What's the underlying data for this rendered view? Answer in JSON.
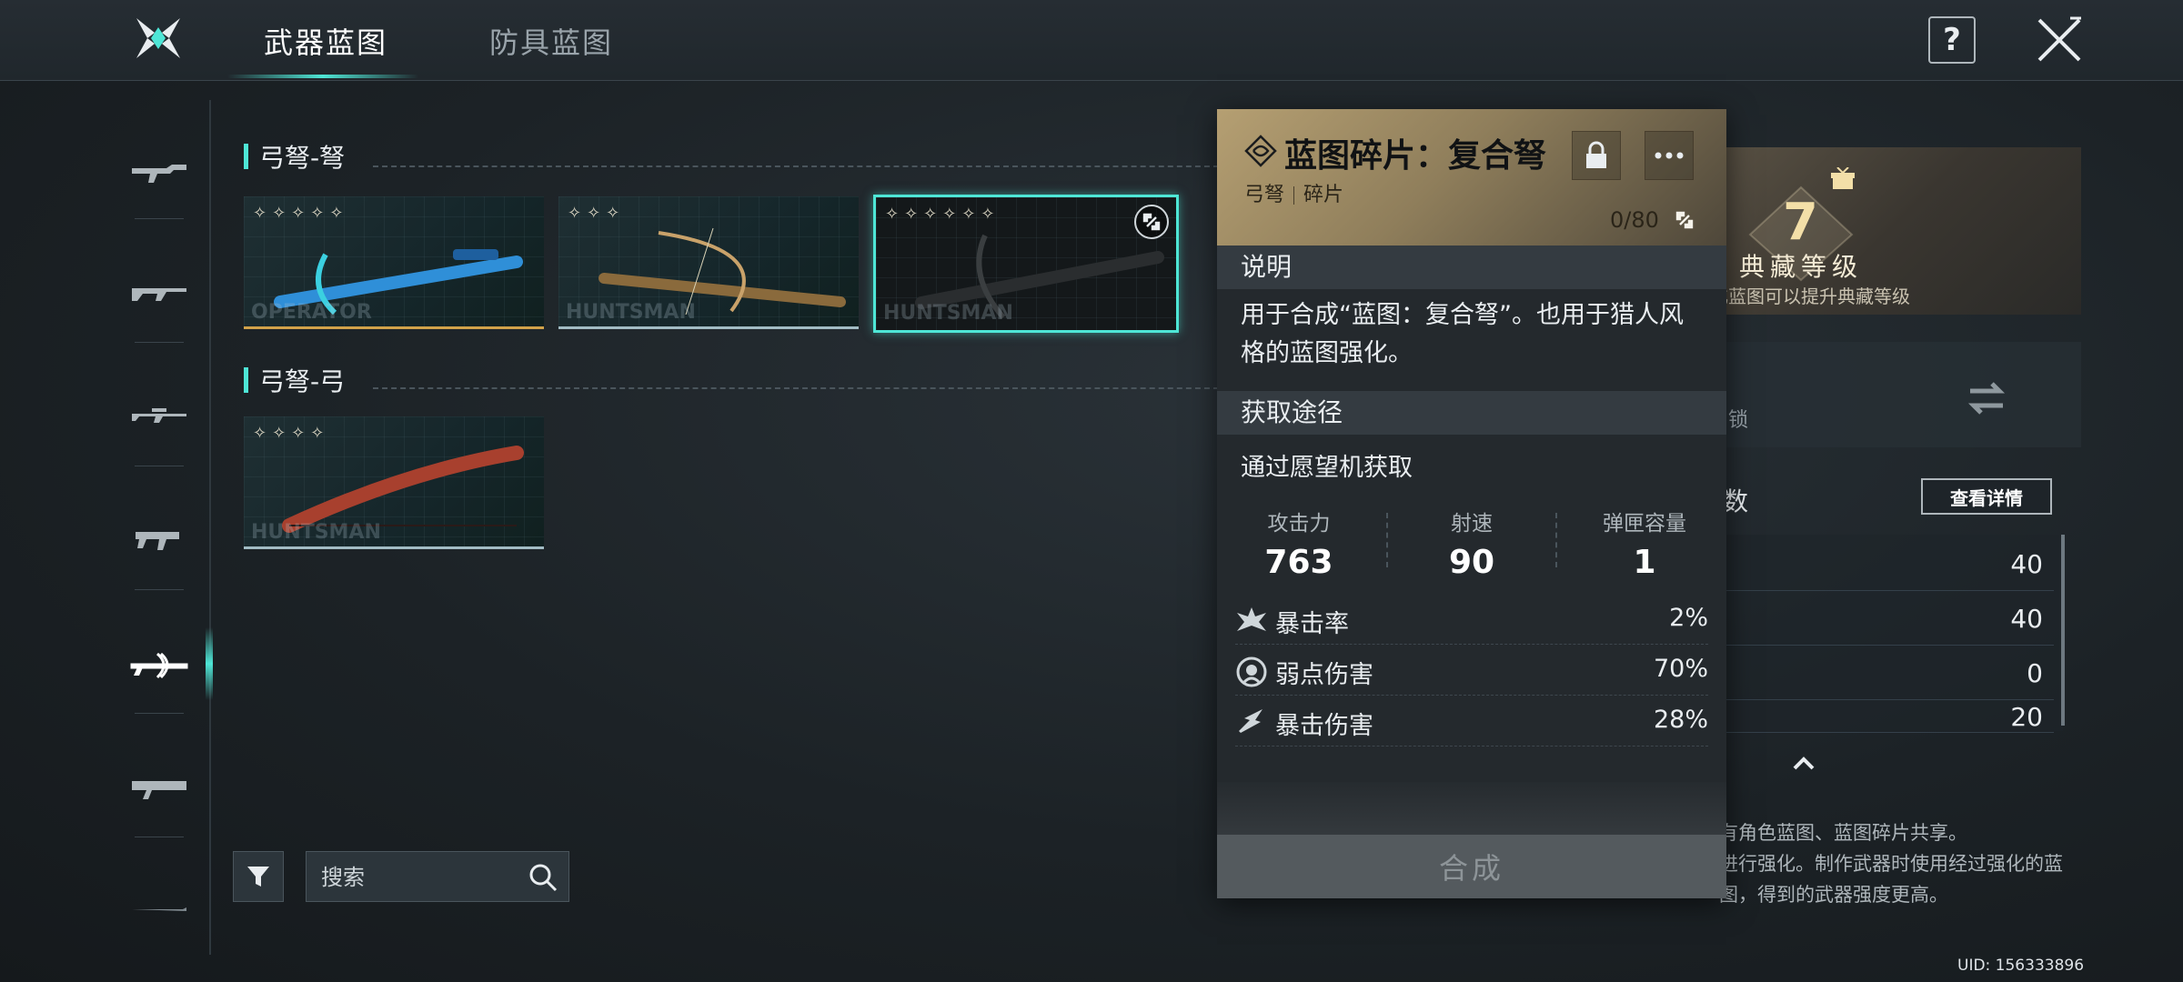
{
  "tabs": [
    {
      "label": "武器蓝图",
      "active": true
    },
    {
      "label": "防具蓝图",
      "active": false
    }
  ],
  "help_label": "?",
  "sections": [
    {
      "title": "弓弩-弩"
    },
    {
      "title": "弓弩-弓"
    }
  ],
  "cards": [
    {
      "stars": "✧✧✧✧✧",
      "brand": "OPERATOR",
      "accent": "#d1a24a"
    },
    {
      "stars": "✧✧✧",
      "brand": "HUNTSMAN",
      "accent": "#a2bcc4"
    },
    {
      "stars": "✧✧✧✧✧✧",
      "brand": "HUNTSMAN",
      "accent": "#4ee6d6",
      "selected": true
    },
    {
      "stars": "✧✧✧✧",
      "brand": "HUNTSMAN",
      "accent": "#a2bcc4"
    }
  ],
  "search": {
    "placeholder": "搜索"
  },
  "popup": {
    "title": "蓝图碎片：复合弩",
    "tags": [
      "弓弩",
      "碎片"
    ],
    "count": "0/80",
    "desc_header": "说明",
    "desc": "用于合成“蓝图：复合弩”。也用于猎人风格的蓝图强化。",
    "source_header": "获取途径",
    "source": "通过愿望机获取",
    "stats": [
      {
        "label": "攻击力",
        "value": "763"
      },
      {
        "label": "射速",
        "value": "90"
      },
      {
        "label": "弹匣容量",
        "value": "1"
      }
    ],
    "attrs": [
      {
        "icon": "crit-rate-icon",
        "label": "暴击率",
        "value": "2%"
      },
      {
        "icon": "weakpoint-damage-icon",
        "label": "弱点伤害",
        "value": "70%"
      },
      {
        "icon": "crit-damage-icon",
        "label": "暴击伤害",
        "value": "28%"
      }
    ],
    "compose_label": "合成"
  },
  "right_panel": {
    "level": "7",
    "level_label": "典藏等级",
    "level_sub": "化蓝图可以提升典藏等级",
    "lock_text": "锁",
    "params_label": "数",
    "detail_button": "查看详情",
    "rows": [
      "40",
      "40",
      "0",
      "20"
    ],
    "notes": [
      "有角色蓝图、蓝图碎片共享。",
      "进行强化。制作武器时使用经过强化的蓝",
      "图，得到的武器强度更高。"
    ]
  },
  "uid": "UID: 156333896",
  "colors": {
    "accent": "#4ee6d6",
    "gold": "#b59f72"
  }
}
